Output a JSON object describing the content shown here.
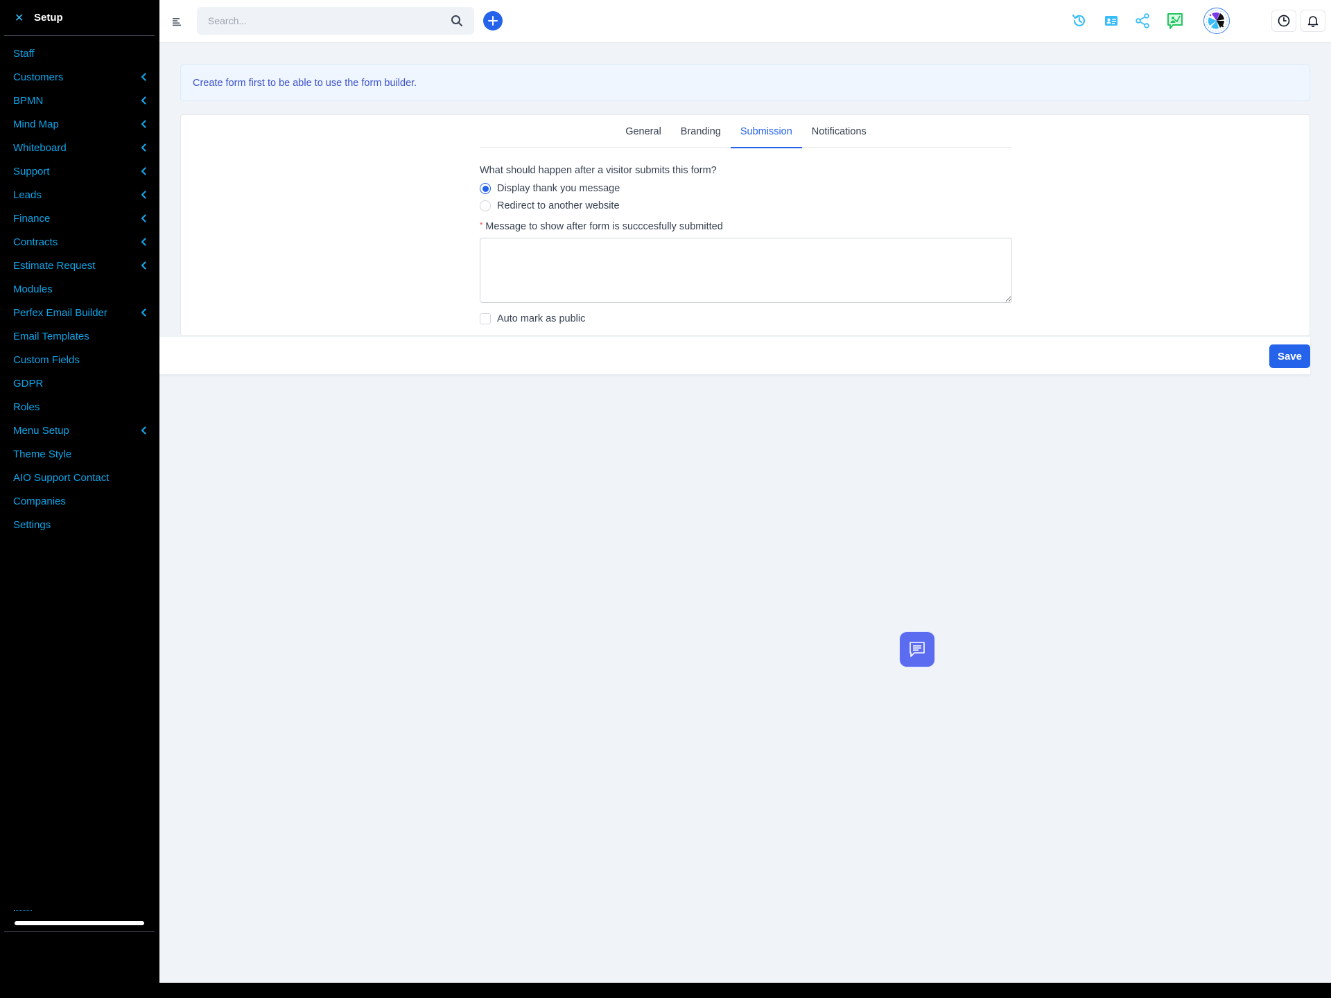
{
  "sidebar": {
    "title": "Setup",
    "close_icon": "close-icon",
    "items": [
      {
        "label": "Staff",
        "has_submenu": false
      },
      {
        "label": "Customers",
        "has_submenu": true
      },
      {
        "label": "BPMN",
        "has_submenu": true
      },
      {
        "label": "Mind Map",
        "has_submenu": true
      },
      {
        "label": "Whiteboard",
        "has_submenu": true
      },
      {
        "label": "Support",
        "has_submenu": true
      },
      {
        "label": "Leads",
        "has_submenu": true
      },
      {
        "label": "Finance",
        "has_submenu": true
      },
      {
        "label": "Contracts",
        "has_submenu": true
      },
      {
        "label": "Estimate Request",
        "has_submenu": true
      },
      {
        "label": "Modules",
        "has_submenu": false
      },
      {
        "label": "Perfex Email Builder",
        "has_submenu": true
      },
      {
        "label": "Email Templates",
        "has_submenu": false
      },
      {
        "label": "Custom Fields",
        "has_submenu": false
      },
      {
        "label": "GDPR",
        "has_submenu": false
      },
      {
        "label": "Roles",
        "has_submenu": false
      },
      {
        "label": "Menu Setup",
        "has_submenu": true
      },
      {
        "label": "Theme Style",
        "has_submenu": false
      },
      {
        "label": "AIO Support Contact",
        "has_submenu": false
      },
      {
        "label": "Companies",
        "has_submenu": false
      },
      {
        "label": "Settings",
        "has_submenu": false
      }
    ]
  },
  "topbar": {
    "search": {
      "placeholder": "Search...",
      "value": ""
    },
    "icons": [
      "menu-icon",
      "search-icon",
      "add-icon",
      "history-icon",
      "contact-card-icon",
      "share-icon",
      "presentation-icon",
      "avatar",
      "clock-icon",
      "bell-icon"
    ]
  },
  "colors": {
    "accent": "#2563eb",
    "sidebar_link": "#0ea5e9",
    "sidebar_bg": "#000000",
    "page_bg": "#f0f3f8",
    "alert_text": "#3b50c8",
    "chat_button": "#5b6cf0",
    "green_icon": "#22c55e",
    "cyan_icon": "#38bdf8"
  },
  "alert": {
    "text": "Create form first to be able to use the form builder."
  },
  "tabs": [
    {
      "label": "General",
      "active": false
    },
    {
      "label": "Branding",
      "active": false
    },
    {
      "label": "Submission",
      "active": true
    },
    {
      "label": "Notifications",
      "active": false
    }
  ],
  "form": {
    "question": "What should happen after a visitor submits this form?",
    "options": [
      {
        "label": "Display thank you message",
        "checked": true
      },
      {
        "label": "Redirect to another website",
        "checked": false
      }
    ],
    "message_label": "Message to show after form is succcesfully submitted",
    "required_marker": "*",
    "message_value": "",
    "auto_public_label": "Auto mark as public",
    "auto_public_checked": false
  },
  "actions": {
    "save_label": "Save"
  }
}
